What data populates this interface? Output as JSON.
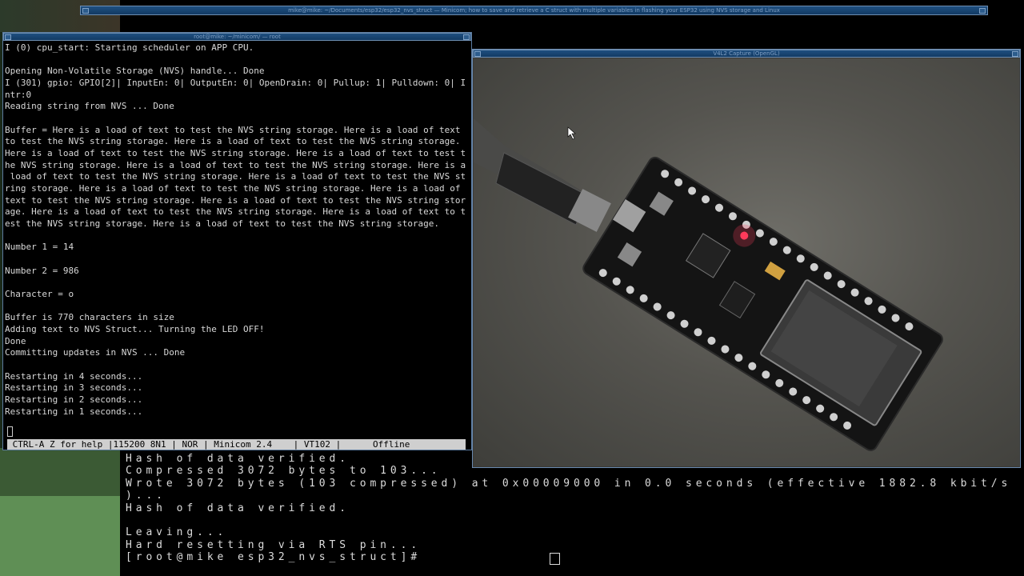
{
  "top_strip": {
    "title": "mike@mike: ~/Documents/esp32/esp32_nvs_struct — Minicom; how to save and retrieve a C struct with multiple variables in flashing your ESP32 using NVS storage and Linux"
  },
  "minicom": {
    "title": "root@mike: ~/minicom/ — root",
    "lines": [
      "I (0) cpu_start: Starting scheduler on APP CPU.",
      "",
      "Opening Non-Volatile Storage (NVS) handle... Done",
      "I (301) gpio: GPIO[2]| InputEn: 0| OutputEn: 0| OpenDrain: 0| Pullup: 1| Pulldown: 0| I",
      "ntr:0",
      "Reading string from NVS ... Done",
      "",
      "Buffer = Here is a load of text to test the NVS string storage. Here is a load of text",
      "to test the NVS string storage. Here is a load of text to test the NVS string storage.",
      "Here is a load of text to test the NVS string storage. Here is a load of text to test t",
      "he NVS string storage. Here is a load of text to test the NVS string storage. Here is a",
      " load of text to test the NVS string storage. Here is a load of text to test the NVS st",
      "ring storage. Here is a load of text to test the NVS string storage. Here is a load of",
      "text to test the NVS string storage. Here is a load of text to test the NVS string stor",
      "age. Here is a load of text to test the NVS string storage. Here is a load of text to t",
      "est the NVS string storage. Here is a load of text to test the NVS string storage.",
      "",
      "Number 1 = 14",
      "",
      "Number 2 = 986",
      "",
      "Character = o",
      "",
      "Buffer is 770 characters in size",
      "Adding text to NVS Struct... Turning the LED OFF!",
      "Done",
      "Committing updates in NVS ... Done",
      "",
      "Restarting in 4 seconds...",
      "Restarting in 3 seconds...",
      "Restarting in 2 seconds...",
      "Restarting in 1 seconds..."
    ],
    "status_bar": " CTRL-A Z for help |115200 8N1 | NOR | Minicom 2.4    | VT102 |      Offline"
  },
  "capture": {
    "title": "V4L2 Capture (OpenGL)"
  },
  "terminal_back": {
    "lines": [
      "Hash of data verified.",
      "Compressed 3072 bytes to 103...",
      "Wrote 3072 bytes (103 compressed) at 0x00009000 in 0.0 seconds (effective 1882.8 kbit/s",
      ")...",
      "Hash of data verified.",
      "",
      "Leaving...",
      "Hard resetting via RTS pin...",
      "[root@mike esp32_nvs_struct]# "
    ]
  },
  "colors": {
    "titlebar": "#1f4f80",
    "terminal_text": "#dcdcdc",
    "status_bar_bg": "#cfcfcf",
    "led": "#ff3a5a"
  }
}
